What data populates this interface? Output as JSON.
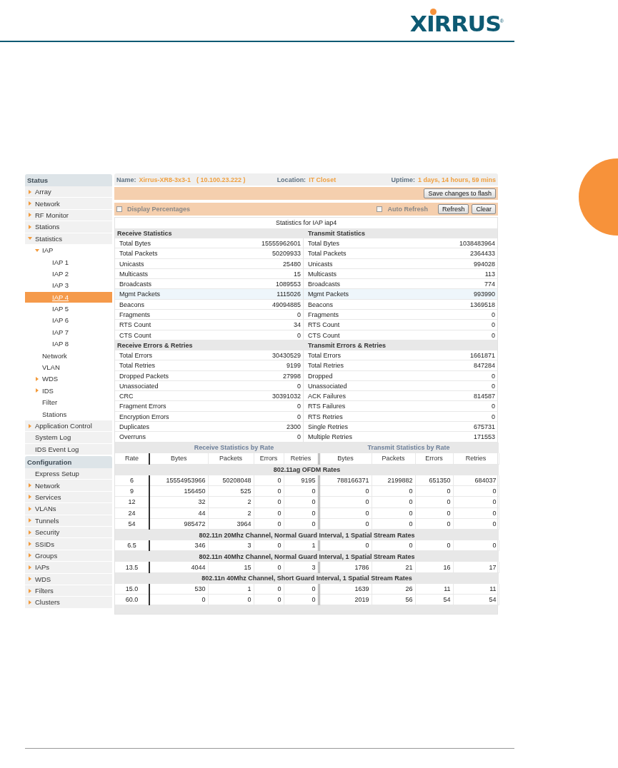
{
  "page_header": {
    "logo": "XIRRUS",
    "logo_mark": "®"
  },
  "sidebar": {
    "sections": [
      {
        "title": "Status",
        "items": [
          {
            "label": "Array",
            "expanded": false,
            "selected": false
          },
          {
            "label": "Network",
            "expanded": false,
            "selected": false
          },
          {
            "label": "RF Monitor",
            "expanded": false,
            "selected": false
          },
          {
            "label": "Stations",
            "expanded": false,
            "selected": false
          },
          {
            "label": "Statistics",
            "expanded": true,
            "selected": false,
            "children": [
              {
                "label": "IAP",
                "expanded": true,
                "selected": false,
                "children": [
                  {
                    "label": "IAP 1",
                    "selected": false
                  },
                  {
                    "label": "IAP 2",
                    "selected": false
                  },
                  {
                    "label": "IAP 3",
                    "selected": false
                  },
                  {
                    "label": "IAP 4",
                    "selected": true
                  },
                  {
                    "label": "IAP 5",
                    "selected": false
                  },
                  {
                    "label": "IAP 6",
                    "selected": false
                  },
                  {
                    "label": "IAP 7",
                    "selected": false
                  },
                  {
                    "label": "IAP 8",
                    "selected": false
                  }
                ]
              },
              {
                "label": "Network",
                "selected": false
              },
              {
                "label": "VLAN",
                "selected": false
              },
              {
                "label": "WDS",
                "expanded": false,
                "selected": false
              },
              {
                "label": "IDS",
                "expanded": false,
                "selected": false
              },
              {
                "label": "Filter",
                "selected": false
              },
              {
                "label": "Stations",
                "selected": false
              }
            ]
          },
          {
            "label": "Application Control",
            "expanded": false,
            "selected": false
          },
          {
            "label": "System Log",
            "selected": false
          },
          {
            "label": "IDS Event Log",
            "selected": false
          }
        ]
      },
      {
        "title": "Configuration",
        "items": [
          {
            "label": "Express Setup",
            "selected": false
          },
          {
            "label": "Network",
            "expanded": false,
            "selected": false
          },
          {
            "label": "Services",
            "expanded": false,
            "selected": false
          },
          {
            "label": "VLANs",
            "expanded": false,
            "selected": false
          },
          {
            "label": "Tunnels",
            "expanded": false,
            "selected": false
          },
          {
            "label": "Security",
            "expanded": false,
            "selected": false
          },
          {
            "label": "SSIDs",
            "expanded": false,
            "selected": false
          },
          {
            "label": "Groups",
            "expanded": false,
            "selected": false
          },
          {
            "label": "IAPs",
            "expanded": false,
            "selected": false
          },
          {
            "label": "WDS",
            "expanded": false,
            "selected": false
          },
          {
            "label": "Filters",
            "expanded": false,
            "selected": false
          },
          {
            "label": "Clusters",
            "expanded": false,
            "selected": false
          }
        ]
      }
    ]
  },
  "info_bar": {
    "name_label": "Name:",
    "name_value": "Xirrus-XR8-3x3-1",
    "address": "( 10.100.23.222 )",
    "location_label": "Location:",
    "location_value": "IT Closet",
    "uptime_label": "Uptime:",
    "uptime_value": "1 days, 14 hours, 59 mins"
  },
  "toolbar": {
    "save_button": "Save changes to flash"
  },
  "options": {
    "display_percentages": {
      "label": "Display Percentages",
      "checked": false
    },
    "auto_refresh": {
      "label": "Auto Refresh",
      "checked": false
    },
    "buttons": [
      "Refresh",
      "Clear"
    ]
  },
  "stats": {
    "title": "Statistics for IAP iap4",
    "sections": [
      {
        "left_title": "Receive Statistics",
        "right_title": "Transmit Statistics",
        "rows": [
          {
            "left_label": "Total Bytes",
            "left_value": "15555962601",
            "right_label": "Total Bytes",
            "right_value": "1038483964",
            "highlighted": false
          },
          {
            "left_label": "Total Packets",
            "left_value": "50209933",
            "right_label": "Total Packets",
            "right_value": "2364433",
            "highlighted": false
          },
          {
            "left_label": "Unicasts",
            "left_value": "25480",
            "right_label": "Unicasts",
            "right_value": "994028",
            "highlighted": false
          },
          {
            "left_label": "Multicasts",
            "left_value": "15",
            "right_label": "Multicasts",
            "right_value": "113",
            "highlighted": false
          },
          {
            "left_label": "Broadcasts",
            "left_value": "1089553",
            "right_label": "Broadcasts",
            "right_value": "774",
            "highlighted": false
          },
          {
            "left_label": "Mgmt Packets",
            "left_value": "1115026",
            "right_label": "Mgmt Packets",
            "right_value": "993990",
            "highlighted": true
          },
          {
            "left_label": "Beacons",
            "left_value": "49094885",
            "right_label": "Beacons",
            "right_value": "1369518",
            "highlighted": false
          },
          {
            "left_label": "Fragments",
            "left_value": "0",
            "right_label": "Fragments",
            "right_value": "0",
            "highlighted": false
          },
          {
            "left_label": "RTS Count",
            "left_value": "34",
            "right_label": "RTS Count",
            "right_value": "0",
            "highlighted": false
          },
          {
            "left_label": "CTS Count",
            "left_value": "0",
            "right_label": "CTS Count",
            "right_value": "0",
            "highlighted": false
          }
        ]
      },
      {
        "left_title": "Receive Errors & Retries",
        "right_title": "Transmit Errors & Retries",
        "rows": [
          {
            "left_label": "Total Errors",
            "left_value": "30430529",
            "right_label": "Total Errors",
            "right_value": "1661871",
            "highlighted": false
          },
          {
            "left_label": "Total Retries",
            "left_value": "9199",
            "right_label": "Total Retries",
            "right_value": "847284",
            "highlighted": false
          },
          {
            "left_label": "Dropped Packets",
            "left_value": "27998",
            "right_label": "Dropped",
            "right_value": "0",
            "highlighted": false
          },
          {
            "left_label": "Unassociated",
            "left_value": "0",
            "right_label": "Unassociated",
            "right_value": "0",
            "highlighted": false
          },
          {
            "left_label": "CRC",
            "left_value": "30391032",
            "right_label": "ACK Failures",
            "right_value": "814587",
            "highlighted": false
          },
          {
            "left_label": "Fragment Errors",
            "left_value": "0",
            "right_label": "RTS Failures",
            "right_value": "0",
            "highlighted": false
          },
          {
            "left_label": "Encryption Errors",
            "left_value": "0",
            "right_label": "RTS Retries",
            "right_value": "0",
            "highlighted": false
          },
          {
            "left_label": "Duplicates",
            "left_value": "2300",
            "right_label": "Single Retries",
            "right_value": "675731",
            "highlighted": false
          },
          {
            "left_label": "Overruns",
            "left_value": "0",
            "right_label": "Multiple Retries",
            "right_value": "171553",
            "highlighted": false
          }
        ]
      }
    ]
  },
  "rate_table": {
    "receive_title": "Receive Statistics by Rate",
    "transmit_title": "Transmit Statistics by Rate",
    "columns": [
      "Rate",
      "Bytes",
      "Packets",
      "Errors",
      "Retries",
      "Bytes",
      "Packets",
      "Errors",
      "Retries"
    ],
    "groups": [
      {
        "title": "802.11ag OFDM Rates",
        "rows": [
          [
            "6",
            "15554953966",
            "50208048",
            "0",
            "9195",
            "788166371",
            "2199882",
            "651350",
            "684037"
          ],
          [
            "9",
            "156450",
            "525",
            "0",
            "0",
            "0",
            "0",
            "0",
            "0"
          ],
          [
            "12",
            "32",
            "2",
            "0",
            "0",
            "0",
            "0",
            "0",
            "0"
          ],
          [
            "24",
            "44",
            "2",
            "0",
            "0",
            "0",
            "0",
            "0",
            "0"
          ],
          [
            "54",
            "985472",
            "3964",
            "0",
            "0",
            "0",
            "0",
            "0",
            "0"
          ]
        ]
      },
      {
        "title": "802.11n 20Mhz Channel, Normal Guard Interval, 1 Spatial Stream Rates",
        "rows": [
          [
            "6.5",
            "346",
            "3",
            "0",
            "1",
            "0",
            "0",
            "0",
            "0"
          ]
        ]
      },
      {
        "title": "802.11n 40Mhz Channel, Normal Guard Interval, 1 Spatial Stream Rates",
        "rows": [
          [
            "13.5",
            "4044",
            "15",
            "0",
            "3",
            "1786",
            "21",
            "16",
            "17"
          ]
        ]
      },
      {
        "title": "802.11n 40Mhz Channel, Short Guard Interval, 1 Spatial Stream Rates",
        "rows": [
          [
            "15.0",
            "530",
            "1",
            "0",
            "0",
            "1639",
            "26",
            "11",
            "11"
          ],
          [
            "60.0",
            "0",
            "0",
            "0",
            "0",
            "2019",
            "56",
            "54",
            "54"
          ]
        ]
      }
    ]
  }
}
